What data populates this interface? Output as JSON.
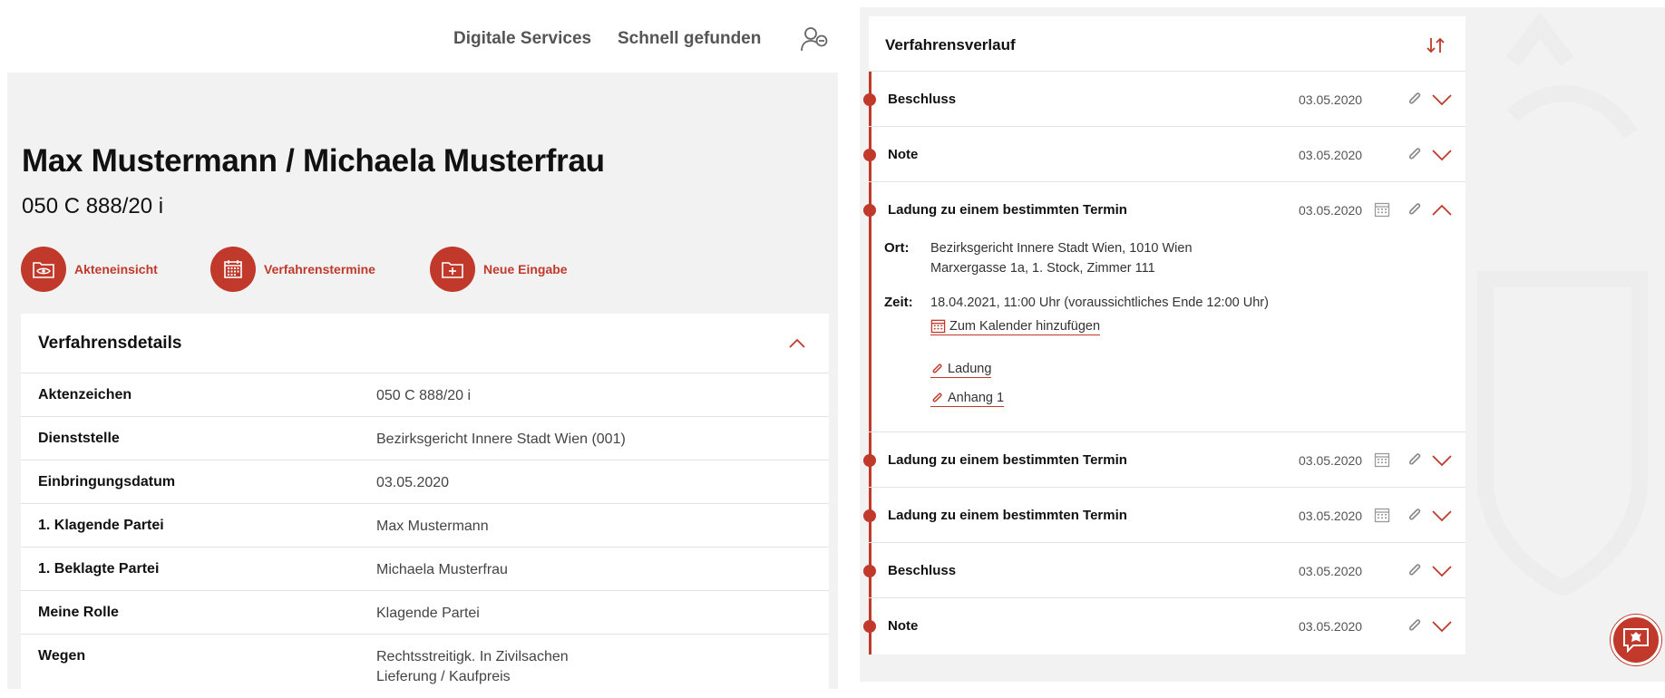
{
  "nav": {
    "digital_services": "Digitale Services",
    "schnell_gefunden": "Schnell gefunden",
    "user_icon": "user-settings-icon"
  },
  "case": {
    "title": "Max Mustermann / Michaela Musterfrau",
    "number": "050 C 888/20 i"
  },
  "actions": [
    {
      "label": "Akteneinsicht",
      "icon": "folder-eye-icon"
    },
    {
      "label": "Verfahrenstermine",
      "icon": "calendar-icon"
    },
    {
      "label": "Neue Eingabe",
      "icon": "folder-plus-icon"
    }
  ],
  "details": {
    "title": "Verfahrensdetails",
    "rows": [
      {
        "key": "Aktenzeichen",
        "value": "050 C 888/20 i"
      },
      {
        "key": "Dienststelle",
        "value": "Bezirksgericht Innere Stadt Wien (001)"
      },
      {
        "key": "Einbringungsdatum",
        "value": "03.05.2020"
      },
      {
        "key": "1. Klagende Partei",
        "value": "Max Mustermann"
      },
      {
        "key": "1. Beklagte Partei",
        "value": "Michaela Musterfrau"
      },
      {
        "key": "Meine Rolle",
        "value": "Klagende Partei"
      },
      {
        "key": "Wegen",
        "value": "Rechtsstreitigk. In Zivilsachen",
        "value2": "Lieferung / Kaufpreis"
      }
    ]
  },
  "verlauf": {
    "title": "Verfahrensverlauf",
    "entries": [
      {
        "title": "Beschluss",
        "date": "03.05.2020"
      },
      {
        "title": "Note",
        "date": "03.05.2020"
      },
      {
        "title": "Ladung zu einem bestimmten Termin",
        "date": "03.05.2020"
      },
      {
        "title": "Ladung zu einem bestimmten Termin",
        "date": "03.05.2020"
      },
      {
        "title": "Ladung zu einem bestimmten Termin",
        "date": "03.05.2020"
      },
      {
        "title": "Beschluss",
        "date": "03.05.2020"
      },
      {
        "title": "Note",
        "date": "03.05.2020"
      }
    ],
    "expanded": {
      "ort_label": "Ort:",
      "ort_line1": "Bezirksgericht Innere Stadt Wien, 1010 Wien",
      "ort_line2": "Marxergasse 1a, 1. Stock, Zimmer 111",
      "zeit_label": "Zeit:",
      "zeit_value": "18.04.2021, 11:00 Uhr (voraussichtliches Ende 12:00 Uhr)",
      "calendar_link": "Zum Kalender hinzufügen",
      "attachments": [
        "Ladung",
        "Anhang 1"
      ]
    }
  },
  "colors": {
    "accent": "#c0392b",
    "panel_bg": "#f2f2f2"
  }
}
